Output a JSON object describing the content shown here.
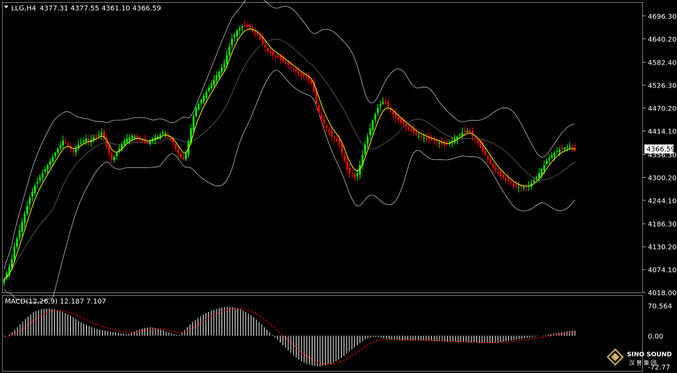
{
  "header": {
    "symbol_tf": "LLG,H4",
    "ohlc": "4377.31 4377.55 4361.10 4366.59"
  },
  "price_axis": {
    "ticks": [
      "4696.30",
      "4640.20",
      "4582.40",
      "4526.30",
      "4470.20",
      "4414.10",
      "4356.30",
      "4300.20",
      "4244.10",
      "4186.30",
      "4130.20",
      "4074.10",
      "4018.00"
    ],
    "current_price": "4366.59"
  },
  "macd": {
    "title": "MACD(12,26,9) 12.187 7.107",
    "ticks": [
      "70.564",
      "0.00",
      "-72.77"
    ]
  },
  "logo": {
    "name": "SINO SOUND",
    "sub": "汉 普 集 团"
  },
  "colors": {
    "bull": "#00ff00",
    "bear": "#ff0000",
    "ma": "#ffff00",
    "bands": "#c0c0c0",
    "signal": "#ff0000",
    "histogram": "#ffffff"
  },
  "chart_data": {
    "type": "candlestick",
    "timeframe": "H4",
    "ylim": [
      4018.0,
      4725.0
    ],
    "closes": [
      4050,
      4065,
      4080,
      4100,
      4130,
      4150,
      4170,
      4190,
      4210,
      4230,
      4250,
      4265,
      4280,
      4290,
      4300,
      4310,
      4320,
      4330,
      4340,
      4350,
      4360,
      4370,
      4380,
      4390,
      4385,
      4378,
      4370,
      4365,
      4372,
      4380,
      4385,
      4390,
      4395,
      4390,
      4392,
      4398,
      4400,
      4405,
      4410,
      4395,
      4375,
      4360,
      4345,
      4350,
      4360,
      4370,
      4380,
      4390,
      4395,
      4398,
      4402,
      4400,
      4398,
      4394,
      4390,
      4388,
      4385,
      4390,
      4395,
      4398,
      4400,
      4404,
      4410,
      4408,
      4400,
      4395,
      4385,
      4370,
      4360,
      4350,
      4345,
      4360,
      4390,
      4420,
      4450,
      4470,
      4480,
      4490,
      4500,
      4510,
      4520,
      4530,
      4540,
      4550,
      4560,
      4570,
      4580,
      4600,
      4620,
      4640,
      4650,
      4660,
      4665,
      4670,
      4672,
      4670,
      4668,
      4660,
      4655,
      4650,
      4640,
      4630,
      4620,
      4610,
      4605,
      4600,
      4598,
      4595,
      4590,
      4585,
      4580,
      4575,
      4570,
      4565,
      4560,
      4555,
      4550,
      4548,
      4545,
      4540,
      4530,
      4510,
      4480,
      4460,
      4440,
      4430,
      4420,
      4410,
      4400,
      4395,
      4390,
      4380,
      4360,
      4340,
      4320,
      4310,
      4305,
      4300,
      4310,
      4330,
      4355,
      4380,
      4400,
      4420,
      4440,
      4455,
      4470,
      4480,
      4485,
      4482,
      4475,
      4465,
      4455,
      4448,
      4440,
      4435,
      4430,
      4425,
      4420,
      4415,
      4410,
      4405,
      4402,
      4400,
      4398,
      4396,
      4394,
      4392,
      4390,
      4388,
      4385,
      4382,
      4380,
      4382,
      4385,
      4390,
      4395,
      4400,
      4405,
      4410,
      4412,
      4414,
      4410,
      4402,
      4395,
      4385,
      4375,
      4365,
      4355,
      4345,
      4335,
      4325,
      4318,
      4310,
      4305,
      4300,
      4295,
      4290,
      4285,
      4280,
      4278,
      4276,
      4275,
      4276,
      4278,
      4280,
      4285,
      4292,
      4300,
      4310,
      4320,
      4330,
      4340,
      4348,
      4355,
      4360,
      4365,
      4368,
      4370,
      4372,
      4374,
      4376,
      4370,
      4366.59
    ],
    "macd_histogram": [
      -2,
      0,
      3,
      8,
      14,
      20,
      27,
      33,
      39,
      45,
      50,
      55,
      58,
      60,
      62,
      63,
      64,
      64,
      63,
      62,
      60,
      58,
      56,
      53,
      50,
      47,
      43,
      39,
      35,
      31,
      28,
      25,
      22,
      20,
      18,
      16,
      14,
      13,
      12,
      11,
      10,
      9,
      8,
      7,
      6,
      5,
      4,
      5,
      7,
      10,
      13,
      15,
      17,
      18,
      19,
      20,
      19,
      18,
      16,
      14,
      12,
      10,
      8,
      6,
      4,
      2,
      3,
      8,
      14,
      20,
      26,
      32,
      37,
      42,
      46,
      50,
      53,
      56,
      59,
      61,
      63,
      65,
      66,
      67,
      68,
      68,
      67,
      66,
      64,
      62,
      59,
      56,
      52,
      48,
      43,
      38,
      32,
      26,
      20,
      14,
      8,
      2,
      -4,
      -10,
      -16,
      -22,
      -28,
      -34,
      -40,
      -46,
      -51,
      -56,
      -60,
      -63,
      -66,
      -68,
      -70,
      -71,
      -72,
      -72,
      -71,
      -70,
      -68,
      -66,
      -63,
      -60,
      -56,
      -52,
      -47,
      -42,
      -37,
      -32,
      -27,
      -22,
      -17,
      -13,
      -9,
      -6,
      -4,
      -3,
      -3,
      -4,
      -5,
      -6,
      -7,
      -8,
      -9,
      -10,
      -10,
      -10,
      -11,
      -11,
      -11,
      -11,
      -11,
      -11,
      -11,
      -11,
      -11,
      -12,
      -12,
      -12,
      -12,
      -13,
      -13,
      -13,
      -13,
      -14,
      -14,
      -14,
      -14,
      -15,
      -15,
      -15,
      -15,
      -16,
      -16,
      -16,
      -16,
      -17,
      -17,
      -17,
      -17,
      -17,
      -17,
      -16,
      -16,
      -15,
      -14,
      -13,
      -12,
      -11,
      -10,
      -9,
      -8,
      -7,
      -6,
      -5,
      -4,
      -3,
      -2,
      -1,
      0,
      1,
      2,
      3,
      4,
      5,
      6,
      7,
      8,
      9,
      10,
      11,
      12,
      12.187
    ]
  }
}
